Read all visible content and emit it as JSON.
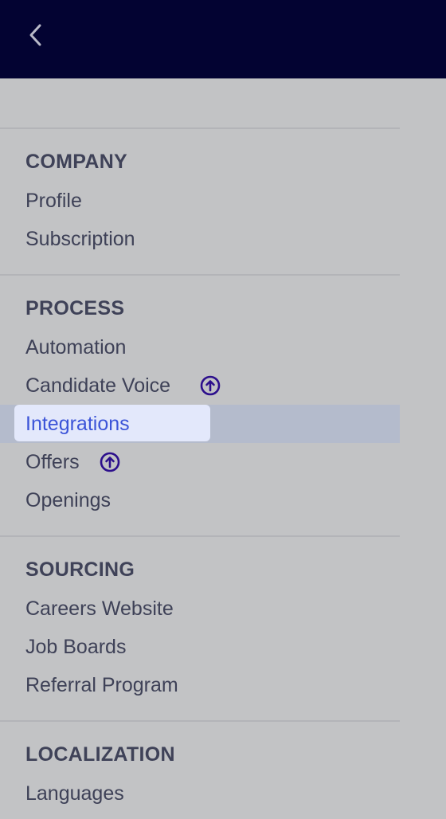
{
  "header": {
    "back_icon": "chevron-left-icon"
  },
  "sections": [
    {
      "title": "COMPANY",
      "items": [
        {
          "label": "Profile"
        },
        {
          "label": "Subscription"
        }
      ]
    },
    {
      "title": "PROCESS",
      "items": [
        {
          "label": "Automation"
        },
        {
          "label": "Candidate Voice",
          "badge": "upgrade-arrow-icon"
        },
        {
          "label": "Integrations",
          "active": true
        },
        {
          "label": "Offers",
          "badge": "upgrade-arrow-icon"
        },
        {
          "label": "Openings"
        }
      ]
    },
    {
      "title": "SOURCING",
      "items": [
        {
          "label": "Careers Website"
        },
        {
          "label": "Job Boards"
        },
        {
          "label": "Referral Program"
        }
      ]
    },
    {
      "title": "LOCALIZATION",
      "items": [
        {
          "label": "Languages"
        }
      ]
    }
  ],
  "colors": {
    "header_bg": "#030332",
    "sidebar_bg": "#c2c3c5",
    "active_row_bg": "#b4bbcc",
    "active_pill_bg": "#e3e8fb",
    "active_text": "#3c54d8",
    "text": "#3e4157",
    "badge": "#2c0f8c"
  }
}
